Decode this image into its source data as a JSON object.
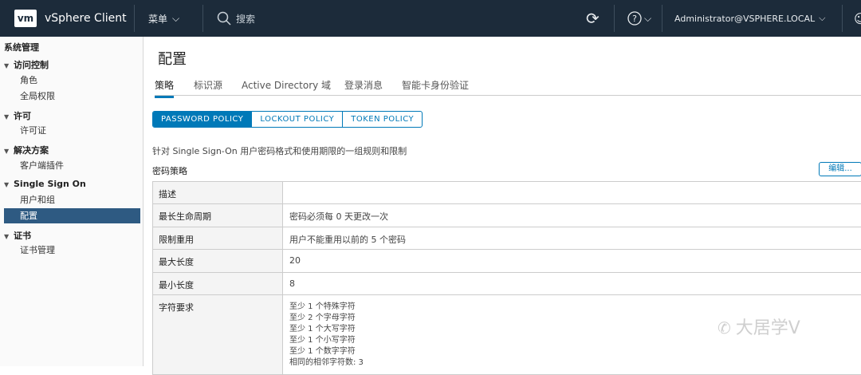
{
  "topbar": {
    "logo": "vm",
    "app_title": "vSphere Client",
    "menu_label": "菜单",
    "search_placeholder": "搜索",
    "user": "Administrator@VSPHERE.LOCAL"
  },
  "sidebar": {
    "header": "系统管理",
    "groups": [
      {
        "label": "访问控制",
        "items": [
          "角色",
          "全局权限"
        ]
      },
      {
        "label": "许可",
        "items": [
          "许可证"
        ]
      },
      {
        "label": "解决方案",
        "items": [
          "客户端插件"
        ]
      },
      {
        "label": "Single Sign On",
        "items": [
          "用户和组",
          "配置"
        ]
      },
      {
        "label": "证书",
        "items": [
          "证书管理"
        ]
      }
    ]
  },
  "main": {
    "title": "配置",
    "tabs": [
      "策略",
      "标识源",
      "Active Directory 域",
      "登录消息",
      "智能卡身份验证"
    ],
    "segments": [
      "PASSWORD POLICY",
      "LOCKOUT POLICY",
      "TOKEN POLICY"
    ],
    "description": "针对 Single Sign-On 用户密码格式和使用期限的一组规则和限制",
    "section_title": "密码策略",
    "edit_button": "编辑...",
    "rows": [
      {
        "key": "描述",
        "value": ""
      },
      {
        "key": "最长生命周期",
        "value": "密码必须每 0 天更改一次"
      },
      {
        "key": "限制重用",
        "value": "用户不能重用以前的 5 个密码"
      },
      {
        "key": "最大长度",
        "value": "20"
      },
      {
        "key": "最小长度",
        "value": "8"
      }
    ],
    "char_req_key": "字符要求",
    "char_req": [
      "至少 1 个特殊字符",
      "至少 2 个字母字符",
      "至少 1 个大写字符",
      "至少 1 个小写字符",
      "至少 1 个数字字符",
      "相同的相邻字符数: 3"
    ]
  },
  "watermark": "大居学V",
  "colors": {
    "topbar": "#1c2b3a",
    "accent": "#0079b8",
    "active_nav": "#2e5a82"
  }
}
